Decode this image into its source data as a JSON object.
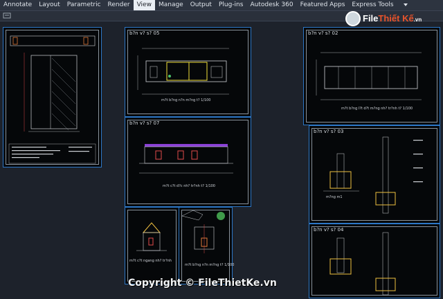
{
  "ribbon": {
    "tabs": [
      {
        "label": "Annotate",
        "active": false
      },
      {
        "label": "Layout",
        "active": false
      },
      {
        "label": "Parametric",
        "active": false
      },
      {
        "label": "Render",
        "active": false
      },
      {
        "label": "View",
        "active": true
      },
      {
        "label": "Manage",
        "active": false
      },
      {
        "label": "Output",
        "active": false
      },
      {
        "label": "Plug-ins",
        "active": false
      },
      {
        "label": "Autodesk 360",
        "active": false
      },
      {
        "label": "Featured Apps",
        "active": false
      },
      {
        "label": "Express Tools",
        "active": false
      }
    ]
  },
  "sheets": [
    {
      "id": "s1",
      "title": "",
      "caption": ""
    },
    {
      "id": "s2",
      "title": "b?n v? s? 05",
      "caption": "m?t b?ng n?n m?ng t? 1/100"
    },
    {
      "id": "s3",
      "title": "b?n v? s? 07",
      "caption": "m?t c?t d?c nh? tr?nh t? 1/100"
    },
    {
      "id": "s4",
      "title": "",
      "caption": "m?t c?t ngang nh? tr?nh"
    },
    {
      "id": "s5",
      "title": "",
      "caption": "m?t b?ng n?n m?ng t? 1/100"
    },
    {
      "id": "s6",
      "title": "b?n v? s? 02",
      "caption": "m?t b?ng l?t d?t m?ng nh? tr?nh t? 1/100"
    },
    {
      "id": "s7",
      "title": "b?n v? s? 03",
      "caption": "m?ng m1"
    },
    {
      "id": "s8",
      "title": "b?n v? s? 04",
      "caption": ""
    }
  ],
  "watermark": {
    "text": "Copyright © FileThietKe.vn"
  },
  "logo": {
    "part1": "File",
    "part2": "Thiết Kế",
    ".vn": ".vn"
  },
  "colors": {
    "sheet_border": "#2d78c8",
    "ribbon": "#2d3440",
    "viewport": "#1d222b"
  }
}
